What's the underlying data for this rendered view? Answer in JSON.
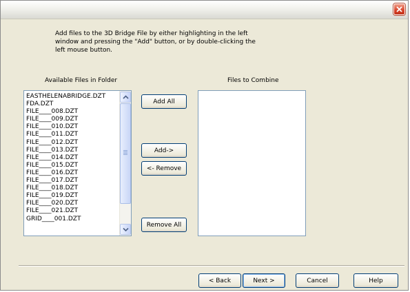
{
  "window": {
    "close_icon": "close-x-icon"
  },
  "instructions": {
    "line1": "Add files to the 3D Bridge File by either highlighting in the left",
    "line2": "window and pressing the \"Add\" button, or by double-clicking the",
    "line3": "left mouse button."
  },
  "available": {
    "label": "Available Files in Folder",
    "items": [
      "EASTHELENABRIDGE.DZT",
      "FDA.DZT",
      "FILE____008.DZT",
      "FILE____009.DZT",
      "FILE____010.DZT",
      "FILE____011.DZT",
      "FILE____012.DZT",
      "FILE____013.DZT",
      "FILE____014.DZT",
      "FILE____015.DZT",
      "FILE____016.DZT",
      "FILE____017.DZT",
      "FILE____018.DZT",
      "FILE____019.DZT",
      "FILE____020.DZT",
      "FILE____021.DZT",
      "GRID____001.DZT"
    ]
  },
  "combine": {
    "label": "Files to Combine",
    "items": []
  },
  "buttons": {
    "add_all": "Add All",
    "add": "Add->",
    "remove": "<- Remove",
    "remove_all": "Remove All",
    "back": "< Back",
    "next": "Next >",
    "cancel": "Cancel",
    "help": "Help"
  }
}
